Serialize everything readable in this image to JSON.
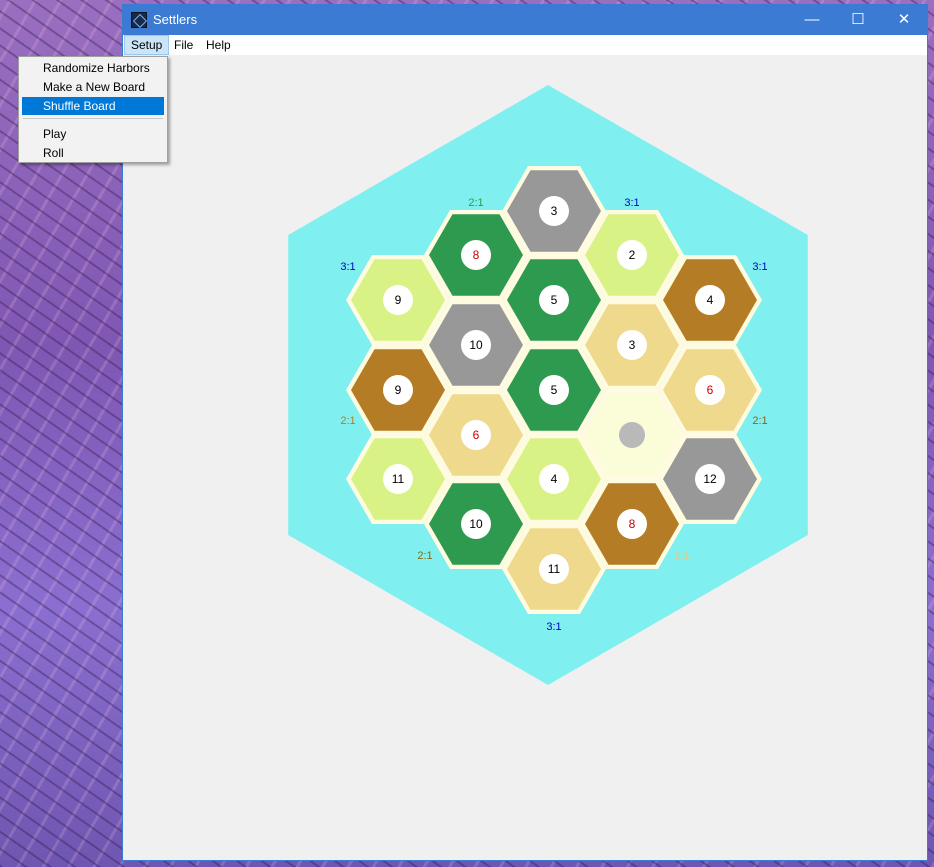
{
  "window": {
    "title": "Settlers",
    "controls": {
      "minimize": "—",
      "maximize": "☐",
      "close": "✕"
    }
  },
  "menubar": {
    "items": [
      "Setup",
      "File",
      "Help"
    ],
    "active": "Setup"
  },
  "dropdown": {
    "items": [
      "Randomize Harbors",
      "Make a New Board",
      "Shuffle Board",
      "Play",
      "Roll"
    ],
    "selected": "Shuffle Board"
  },
  "colors": {
    "sea": "#7ff0ef",
    "border": "#fffbe0",
    "forest": "#2e9a4f",
    "pasture": "#d8f285",
    "hills": "#b47c24",
    "mountains": "#989898",
    "fields": "#efd98d",
    "desert": "#fbfdd8",
    "number_red": "#cc0000",
    "harbor_3to1": "#0000cc"
  },
  "board": {
    "tiles": [
      {
        "terrain": "mountains",
        "number": "3",
        "red": false
      },
      {
        "terrain": "forest",
        "number": "8",
        "red": true
      },
      {
        "terrain": "pasture",
        "number": "2",
        "red": false
      },
      {
        "terrain": "pasture",
        "number": "9",
        "red": false
      },
      {
        "terrain": "forest",
        "number": "5",
        "red": false
      },
      {
        "terrain": "hills",
        "number": "4",
        "red": false
      },
      {
        "terrain": "mountains",
        "number": "10",
        "red": false
      },
      {
        "terrain": "fields",
        "number": "3",
        "red": false
      },
      {
        "terrain": "hills",
        "number": "9",
        "red": false
      },
      {
        "terrain": "forest",
        "number": "5",
        "red": false
      },
      {
        "terrain": "fields",
        "number": "6",
        "red": true
      },
      {
        "terrain": "fields",
        "number": "6",
        "red": true
      },
      {
        "terrain": "desert",
        "number": "",
        "red": false
      },
      {
        "terrain": "pasture",
        "number": "11",
        "red": false
      },
      {
        "terrain": "pasture",
        "number": "4",
        "red": false
      },
      {
        "terrain": "mountains",
        "number": "12",
        "red": false
      },
      {
        "terrain": "forest",
        "number": "10",
        "red": false
      },
      {
        "terrain": "hills",
        "number": "8",
        "red": true
      },
      {
        "terrain": "fields",
        "number": "11",
        "red": false
      }
    ],
    "harbors": [
      {
        "label": "2:1",
        "color": "#2e9a4f"
      },
      {
        "label": "3:1",
        "color": "#0000cc"
      },
      {
        "label": "3:1",
        "color": "#0000cc"
      },
      {
        "label": "3:1",
        "color": "#0000cc"
      },
      {
        "label": "2:1",
        "color": "#b47c24"
      },
      {
        "label": "2:1",
        "color": "#9a5a1a"
      },
      {
        "label": "2:1",
        "color": "#8a6a10"
      },
      {
        "label": "2:1",
        "color": "#d8d090"
      },
      {
        "label": "3:1",
        "color": "#0000cc"
      }
    ]
  }
}
